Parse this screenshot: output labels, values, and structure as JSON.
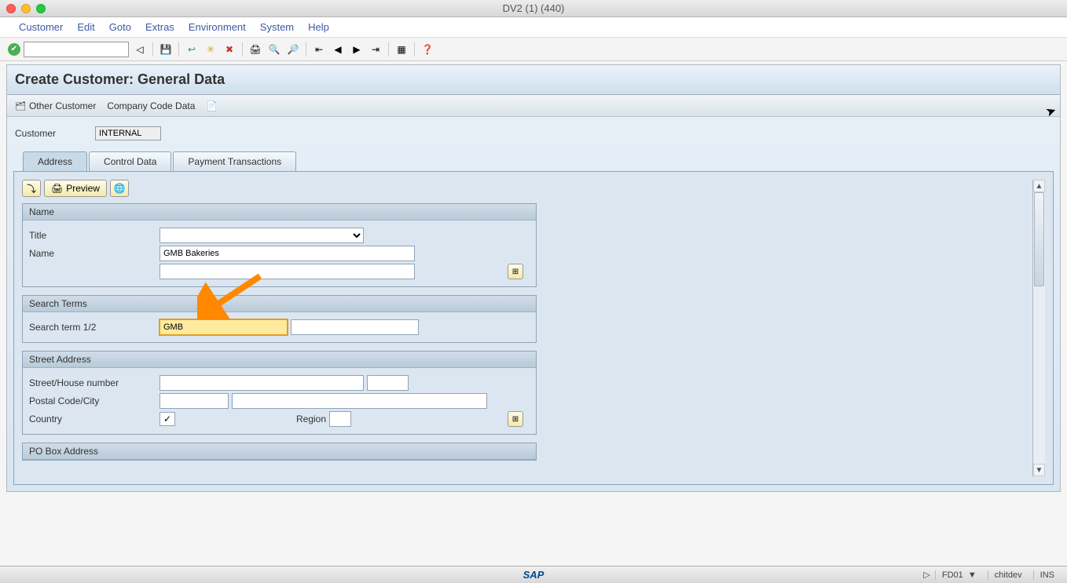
{
  "window": {
    "title": "DV2 (1) (440)"
  },
  "menu": [
    "Customer",
    "Edit",
    "Goto",
    "Extras",
    "Environment",
    "System",
    "Help"
  ],
  "page": {
    "title": "Create Customer: General Data",
    "subtoolbar": {
      "other": "Other Customer",
      "company": "Company Code Data"
    },
    "header": {
      "customer_label": "Customer",
      "customer_value": "INTERNAL"
    }
  },
  "tabs": {
    "address": "Address",
    "control": "Control Data",
    "payment": "Payment Transactions"
  },
  "actions": {
    "preview": "Preview"
  },
  "groups": {
    "name": {
      "header": "Name",
      "title_label": "Title",
      "title_value": "",
      "name_label": "Name",
      "name_value": "GMB Bakeries",
      "name2_value": ""
    },
    "search": {
      "header": "Search Terms",
      "term_label": "Search term 1/2",
      "term1": "GMB",
      "term2": ""
    },
    "street": {
      "header": "Street Address",
      "street_label": "Street/House number",
      "street": "",
      "house": "",
      "postal_label": "Postal Code/City",
      "postal": "",
      "city": "",
      "country_label": "Country",
      "country": "",
      "region_label": "Region",
      "region": ""
    },
    "pobox": {
      "header": "PO Box Address"
    }
  },
  "status": {
    "tcode": "FD01",
    "user": "chitdev",
    "mode": "INS"
  }
}
